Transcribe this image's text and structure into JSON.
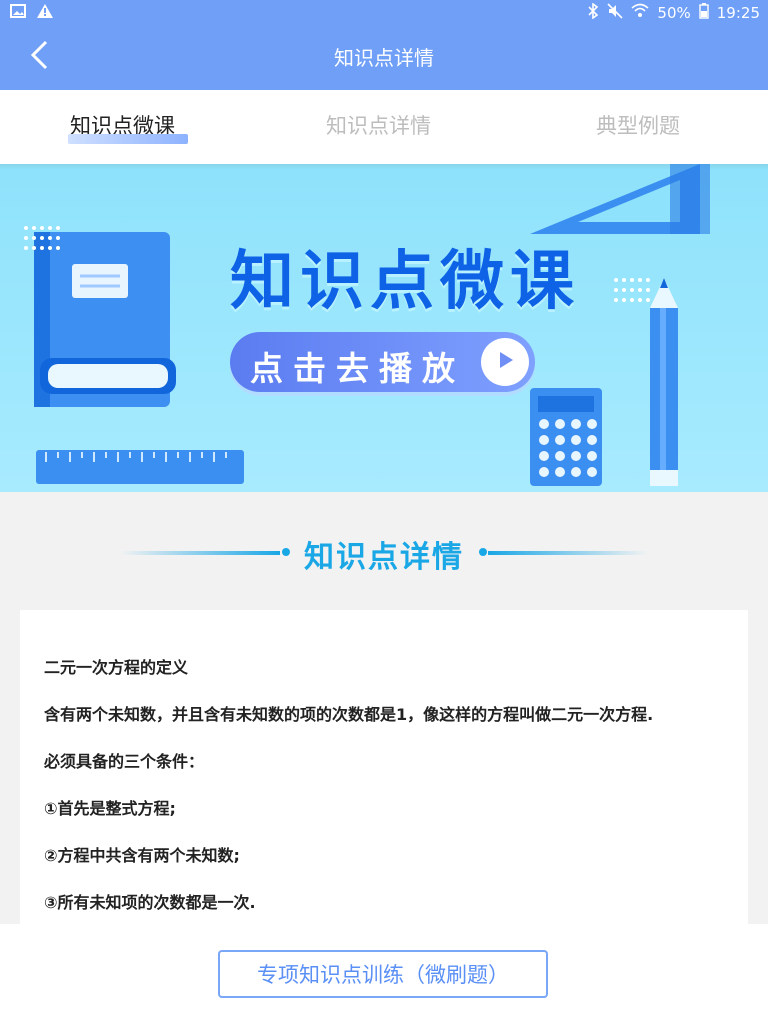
{
  "status_bar": {
    "battery": "50%",
    "time": "19:25",
    "icons": [
      "image-icon",
      "warning-icon",
      "bluetooth-icon",
      "mute-icon",
      "wifi-icon",
      "battery-icon"
    ]
  },
  "app_bar": {
    "title": "知识点详情",
    "back_icon": "chevron-left-icon"
  },
  "tabs": [
    {
      "label": "知识点微课",
      "active": true
    },
    {
      "label": "知识点详情",
      "active": false
    },
    {
      "label": "典型例题",
      "active": false
    }
  ],
  "banner": {
    "title": "知识点微课",
    "play_label": "点击去播放"
  },
  "section": {
    "title": "知识点详情"
  },
  "content": {
    "lines": [
      "二元一次方程的定义",
      "含有两个未知数，并且含有未知数的项的次数都是1，像这样的方程叫做二元一次方程.",
      "必须具备的三个条件：",
      "①首先是整式方程;",
      "②方程中共含有两个未知数;",
      "③所有未知项的次数都是一次."
    ]
  },
  "footer": {
    "button_label": "专项知识点训练（微刷题）"
  },
  "colors": {
    "primary": "#6f9ff7",
    "accent": "#1aa7e6",
    "banner_bg": "#8ee2fb"
  }
}
